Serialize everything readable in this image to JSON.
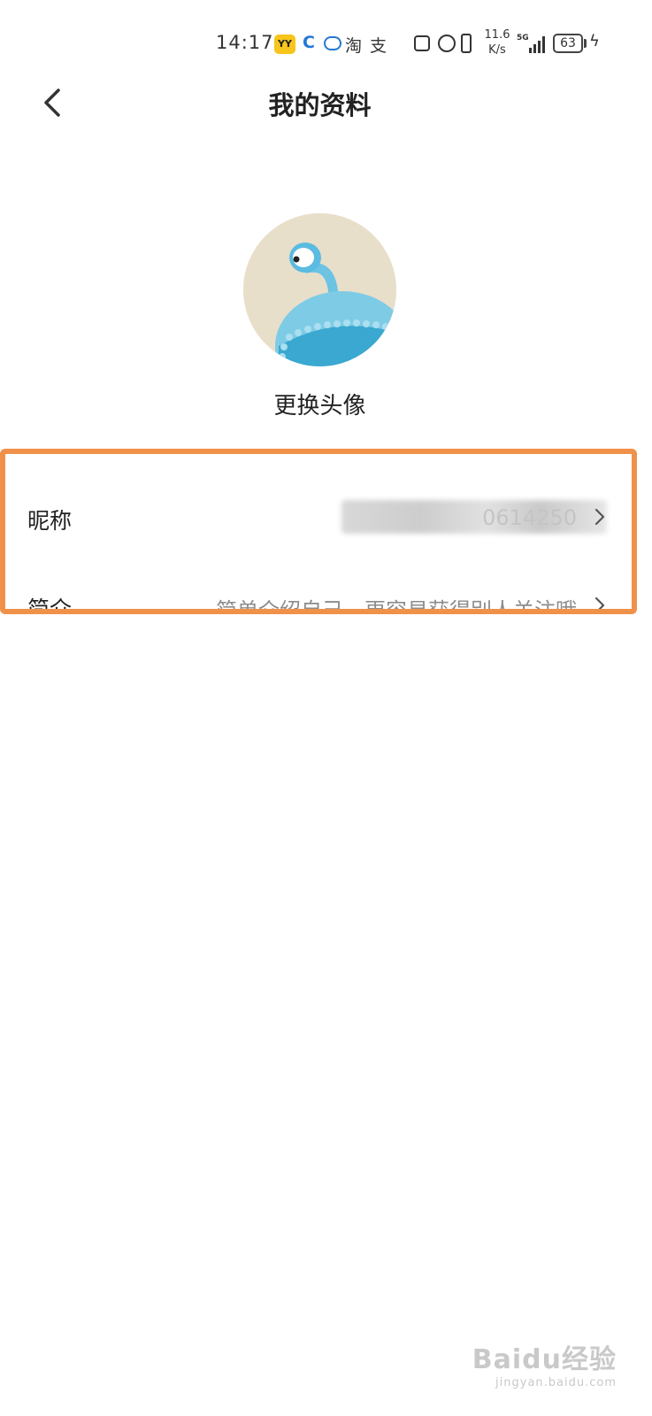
{
  "status_bar": {
    "time": "14:17",
    "yy_label": "YY",
    "taobao_glyph": "淘",
    "alipay_glyph": "支",
    "net_speed_value": "11.6",
    "net_speed_unit": "K/s",
    "network_type": "5G",
    "battery_level": "63",
    "icons": [
      "yy-app-icon",
      "c-app-icon",
      "chat-app-icon",
      "taobao-icon",
      "alipay-icon",
      "nfc-icon",
      "alarm-icon",
      "vibrate-icon",
      "signal-icon",
      "battery-icon",
      "charging-icon"
    ]
  },
  "header": {
    "title": "我的资料",
    "back_icon": "chevron-left-icon"
  },
  "avatar": {
    "change_label": "更换头像",
    "colors": {
      "background": "#e8dfca",
      "body": "#7ecbe6",
      "body_dark": "#3aa8d0"
    }
  },
  "profile_rows": [
    {
      "label": "昵称",
      "value": "0614250"
    },
    {
      "label": "简介",
      "value": "简单介绍自己，更容易获得别人关注哦"
    }
  ],
  "watermark": {
    "logo": "Baidu经验",
    "subtitle": "jingyan.baidu.com"
  },
  "colors": {
    "highlight_border": "#f0914a",
    "text_primary": "#222222",
    "text_secondary": "#8c8c8c"
  }
}
